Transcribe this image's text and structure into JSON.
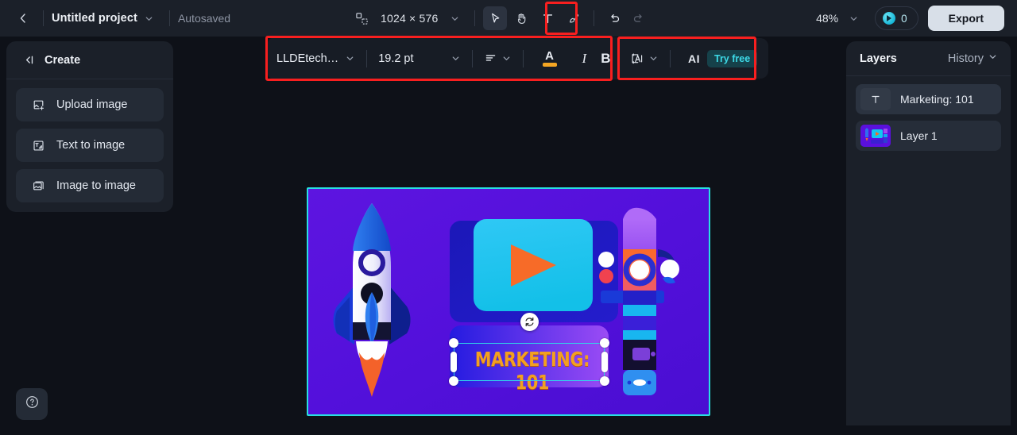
{
  "topbar": {
    "back_icon": "chevron-left-icon",
    "project_name": "Untitled project",
    "project_caret": "chevron-down-icon",
    "autosaved": "Autosaved",
    "resize_icon": "resize-icon",
    "dimensions": "1024 × 576",
    "dimensions_caret": "chevron-down-icon",
    "tools": [
      {
        "name": "select-tool",
        "icon": "cursor-arrow-icon",
        "active": true
      },
      {
        "name": "hand-tool",
        "icon": "hand-icon",
        "active": false
      },
      {
        "name": "text-tool",
        "icon": "text-t-icon",
        "active": false
      },
      {
        "name": "brush-tool",
        "icon": "brush-icon",
        "active": false
      }
    ],
    "undo_icon": "undo-arrow-icon",
    "redo_icon": "redo-arrow-icon",
    "zoom": "48%",
    "zoom_caret": "chevron-down-icon",
    "credits_icon": "credit-token-icon",
    "credits_count": "0",
    "export_label": "Export"
  },
  "left_panel": {
    "collapse_icon": "collapse-left-icon",
    "title": "Create",
    "items": [
      {
        "label": "Upload image",
        "icon": "upload-image-icon"
      },
      {
        "label": "Text to image",
        "icon": "text-to-image-icon"
      },
      {
        "label": "Image to image",
        "icon": "image-to-image-icon"
      }
    ],
    "help_icon": "question-mark-icon"
  },
  "text_toolbar": {
    "font_family": "LLDEtech…",
    "font_caret": "chevron-down-icon",
    "font_size": "19.2 pt",
    "size_caret": "chevron-down-icon",
    "align_icon": "text-align-left-icon",
    "align_caret": "chevron-down-icon",
    "color_letter": "A",
    "color_swatch": "#f5a623",
    "italic_label": "I",
    "bold_label": "B"
  },
  "ai_toolbar": {
    "spacing_icon": "line-height-icon",
    "spacing_caret": "chevron-down-icon",
    "ai_label": "AI",
    "try_free_label": "Try free",
    "try_free_color": "#3ddbe8"
  },
  "right_panel": {
    "tab_layers": "Layers",
    "tab_history": "History",
    "history_caret": "chevron-down-icon",
    "layers": [
      {
        "name": "Marketing: 101",
        "thumb": "text-t-icon",
        "selected": true
      },
      {
        "name": "Layer 1",
        "thumb": "artwork-thumbnail",
        "selected": false
      }
    ]
  },
  "canvas": {
    "headline_text": "MARKETING: 101",
    "headline_color": "#f2a020",
    "background_color": "#5a10dd",
    "border_color": "#28e0e0",
    "selection_color": "#2fd8e8",
    "rotate_icon": "rotate-handle-icon",
    "play_icon": "play-triangle-icon",
    "rocket_icon": "rocket-illustration"
  },
  "annotations": {
    "box1": "text-toolbar-highlight",
    "box2": "ai-toolbar-highlight",
    "box3": "text-tool-highlight",
    "color": "#f81f1f"
  }
}
